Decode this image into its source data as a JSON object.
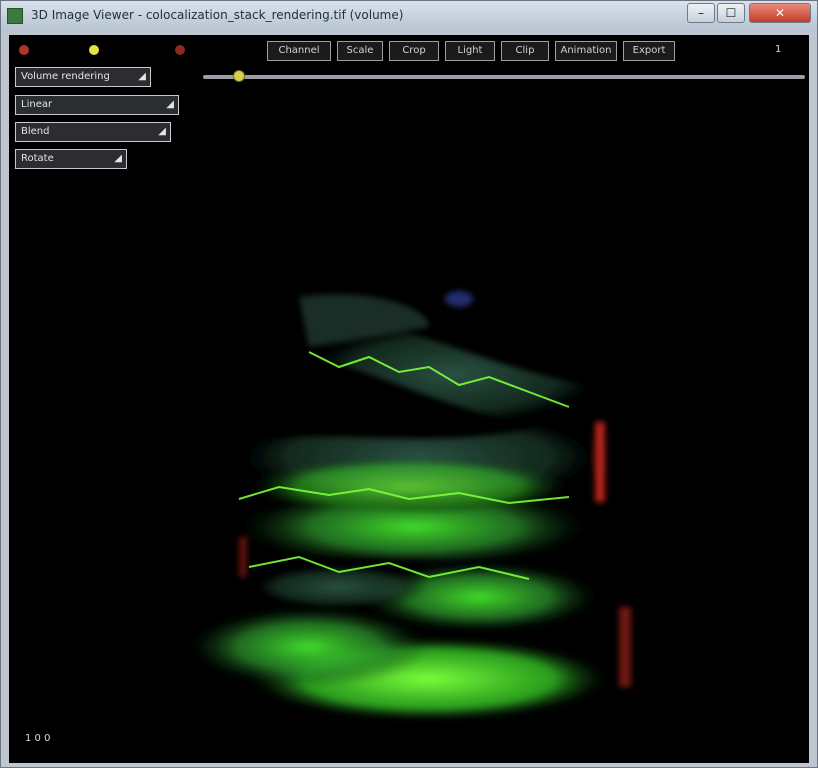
{
  "window": {
    "title": "3D Image Viewer - colocalization_stack_rendering.tif (volume)",
    "buttons": {
      "minimize": "–",
      "maximize": "☐",
      "close": "✕"
    }
  },
  "toolbar": {
    "label_left": "",
    "label_mid": "",
    "tabs": [
      "Channel",
      "Scale",
      "Crop",
      "Light",
      "Clip",
      "Animation",
      "Export"
    ],
    "end_text": "1"
  },
  "slider": {
    "value": 0.06
  },
  "panel": {
    "items": [
      {
        "label": "Volume rendering",
        "arrow": "◢"
      },
      {
        "label": "Linear",
        "arrow": "◢"
      },
      {
        "label": "Blend",
        "arrow": "◢"
      },
      {
        "label": "Rotate",
        "arrow": "◢"
      }
    ]
  },
  "status": {
    "text": "1   0   0"
  },
  "colors": {
    "accent": "#e6e24a",
    "volume_green": "#3bdc2a",
    "volume_red": "#d2281e",
    "background": "#000000"
  },
  "icons": [
    "app-icon",
    "record-icon",
    "snapshot-icon",
    "reset-icon"
  ]
}
